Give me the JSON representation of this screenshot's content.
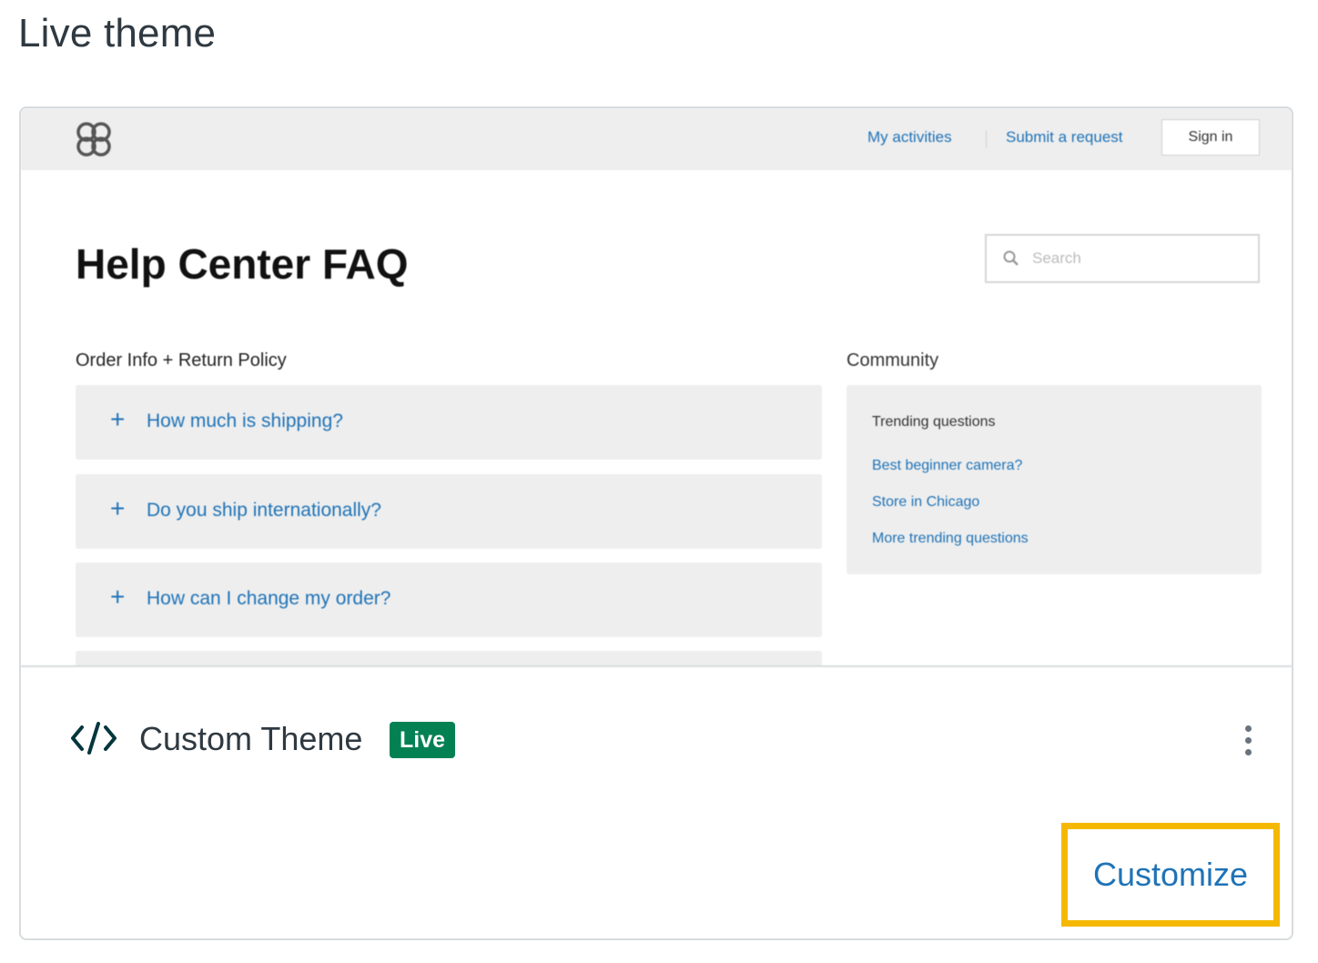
{
  "page": {
    "title": "Live theme"
  },
  "preview": {
    "header": {
      "logo_icon": "knot-logo-icon",
      "nav": [
        "My activities",
        "Submit a request"
      ],
      "sign_in": "Sign in"
    },
    "title": "Help Center FAQ",
    "search": {
      "placeholder": "Search",
      "icon": "search-icon"
    },
    "faq": {
      "section_title": "Order Info + Return Policy",
      "items": [
        "How much is shipping?",
        "Do you ship internationally?",
        "How can I change my order?"
      ]
    },
    "community": {
      "section_title": "Community",
      "heading": "Trending questions",
      "links": [
        "Best beginner camera?",
        "Store in Chicago",
        "More trending questions"
      ]
    }
  },
  "theme": {
    "icon": "code-icon",
    "name": "Custom Theme",
    "badge": "Live",
    "menu_icon": "more-vertical-icon",
    "customize_label": "Customize"
  },
  "colors": {
    "accent_blue": "#1f73b7",
    "live_green": "#038153",
    "highlight_yellow": "#f5b800"
  }
}
